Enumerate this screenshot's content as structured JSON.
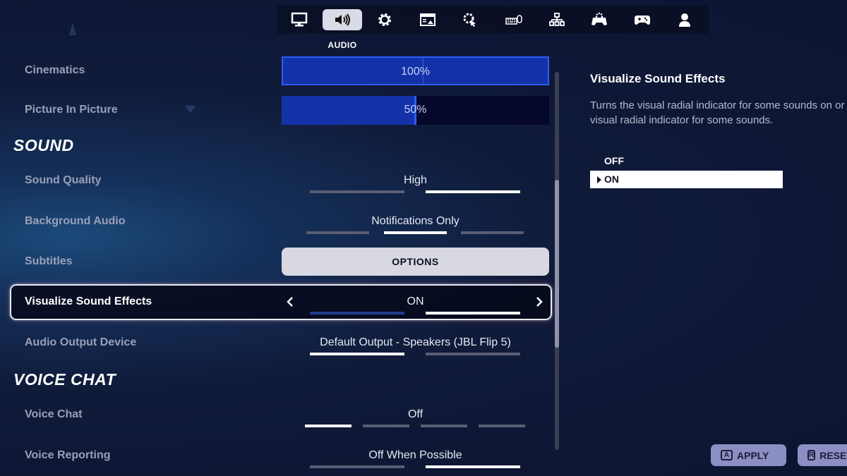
{
  "nav": {
    "tabs": [
      {
        "icon": "monitor-icon"
      },
      {
        "icon": "speaker-icon",
        "active": true
      },
      {
        "icon": "gear-icon"
      },
      {
        "icon": "hud-icon"
      },
      {
        "icon": "touch-gear-icon"
      },
      {
        "icon": "keyboard-mouse-icon"
      },
      {
        "icon": "network-icon"
      },
      {
        "icon": "controller-gear-icon"
      },
      {
        "icon": "controller-icon"
      },
      {
        "icon": "account-icon"
      }
    ],
    "active_label": "AUDIO"
  },
  "settings": {
    "cinematics": {
      "label": "Cinematics",
      "value": "100%",
      "percent": 100
    },
    "pip": {
      "label": "Picture In Picture",
      "value": "50%",
      "percent": 50
    },
    "sound_section": "SOUND",
    "sound_quality": {
      "label": "Sound Quality",
      "value": "High"
    },
    "background_audio": {
      "label": "Background Audio",
      "value": "Notifications Only"
    },
    "subtitles": {
      "label": "Subtitles",
      "button": "OPTIONS"
    },
    "visualize": {
      "label": "Visualize Sound Effects",
      "value": "ON"
    },
    "audio_output": {
      "label": "Audio Output Device",
      "value": "Default Output - Speakers (JBL Flip 5)"
    },
    "voice_section": "VOICE CHAT",
    "voice_chat": {
      "label": "Voice Chat",
      "value": "Off"
    },
    "voice_reporting": {
      "label": "Voice Reporting",
      "value": "Off When Possible"
    }
  },
  "description": {
    "title": "Visualize Sound Effects",
    "text_line1": "Turns the visual radial indicator for some sounds on or off. Turns on the",
    "text_line2": "visual radial indicator for some sounds.",
    "options": [
      "OFF",
      "ON"
    ],
    "selected": "ON"
  },
  "footer": {
    "apply": {
      "key": "A",
      "label": "APPLY"
    },
    "reset": {
      "key": "R",
      "label": "RESET"
    }
  },
  "colors": {
    "accent_blue": "#2d5bff",
    "slider_fill": "#1432a8",
    "footer_button": "#8c8fc4"
  }
}
